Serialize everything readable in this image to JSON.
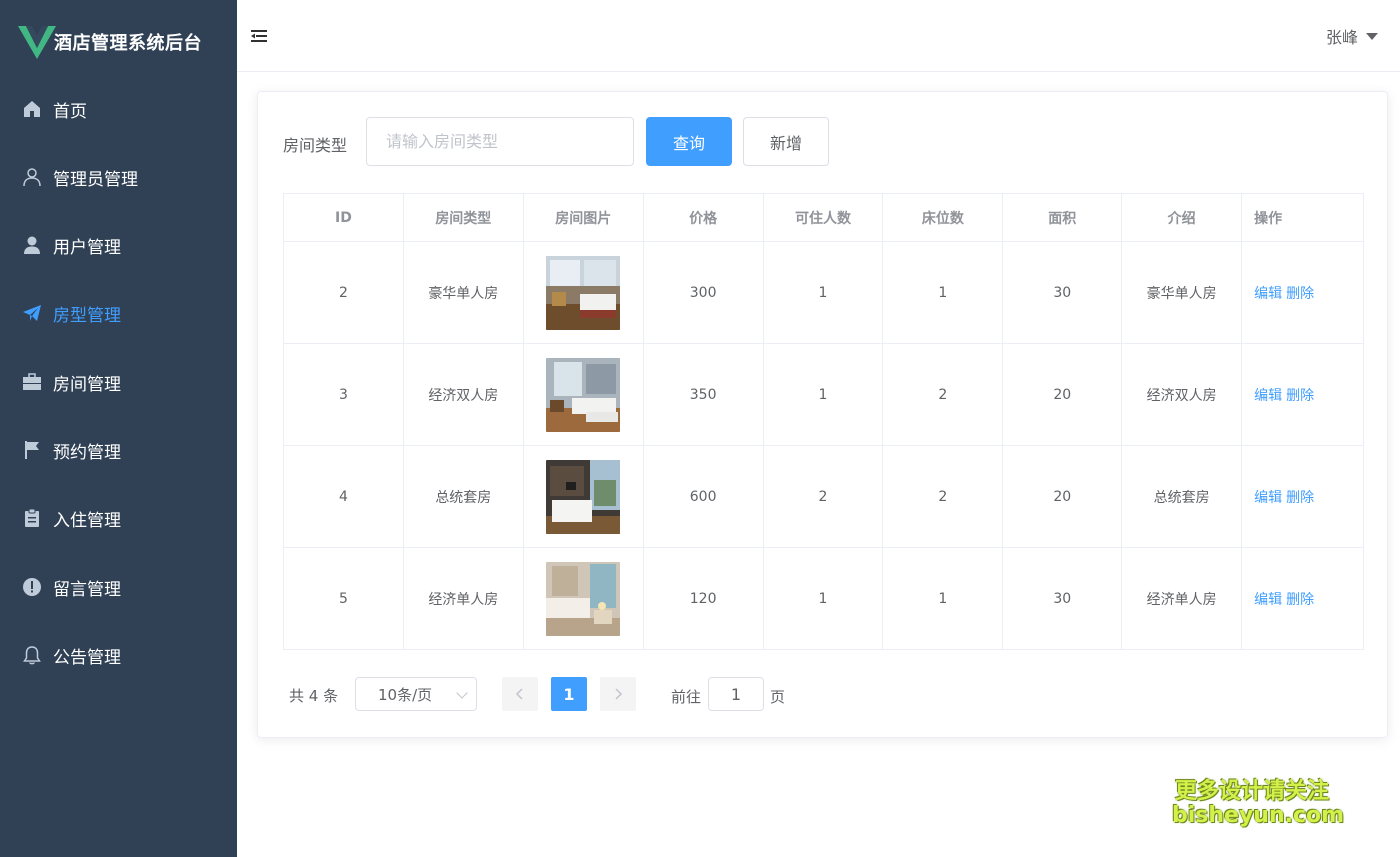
{
  "app": {
    "title": "酒店管理系统后台",
    "accent": "#409eff",
    "sidebar_bg": "#304156"
  },
  "sidebar": {
    "items": [
      {
        "label": "首页",
        "icon": "home-icon"
      },
      {
        "label": "管理员管理",
        "icon": "user-outline-icon"
      },
      {
        "label": "用户管理",
        "icon": "user-filled-icon"
      },
      {
        "label": "房型管理",
        "icon": "paper-plane-icon",
        "active": true
      },
      {
        "label": "房间管理",
        "icon": "briefcase-icon"
      },
      {
        "label": "预约管理",
        "icon": "flag-icon"
      },
      {
        "label": "入住管理",
        "icon": "clipboard-icon"
      },
      {
        "label": "留言管理",
        "icon": "warning-circle-icon"
      },
      {
        "label": "公告管理",
        "icon": "bell-icon"
      }
    ]
  },
  "header": {
    "user_name": "张峰"
  },
  "search": {
    "label": "房间类型",
    "placeholder": "请输入房间类型",
    "query_label": "查询",
    "add_label": "新增"
  },
  "table": {
    "columns": [
      "ID",
      "房间类型",
      "房间图片",
      "价格",
      "可住人数",
      "床位数",
      "面积",
      "介绍",
      "操作"
    ],
    "rows": [
      {
        "id": "2",
        "type": "豪华单人房",
        "price": "300",
        "capacity": "1",
        "beds": "1",
        "area": "30",
        "intro": "豪华单人房"
      },
      {
        "id": "3",
        "type": "经济双人房",
        "price": "350",
        "capacity": "1",
        "beds": "2",
        "area": "20",
        "intro": "经济双人房"
      },
      {
        "id": "4",
        "type": "总统套房",
        "price": "600",
        "capacity": "2",
        "beds": "2",
        "area": "20",
        "intro": "总统套房"
      },
      {
        "id": "5",
        "type": "经济单人房",
        "price": "120",
        "capacity": "1",
        "beds": "1",
        "area": "30",
        "intro": "经济单人房"
      }
    ],
    "edit_label": "编辑",
    "delete_label": "删除"
  },
  "pagination": {
    "total_text": "共 4 条",
    "page_size": "10条/页",
    "current_page": "1",
    "goto_label": "前往",
    "goto_value": "1",
    "goto_suffix": "页"
  },
  "watermark": {
    "line1": "更多设计请关注",
    "line2": "bisheyun.com"
  }
}
